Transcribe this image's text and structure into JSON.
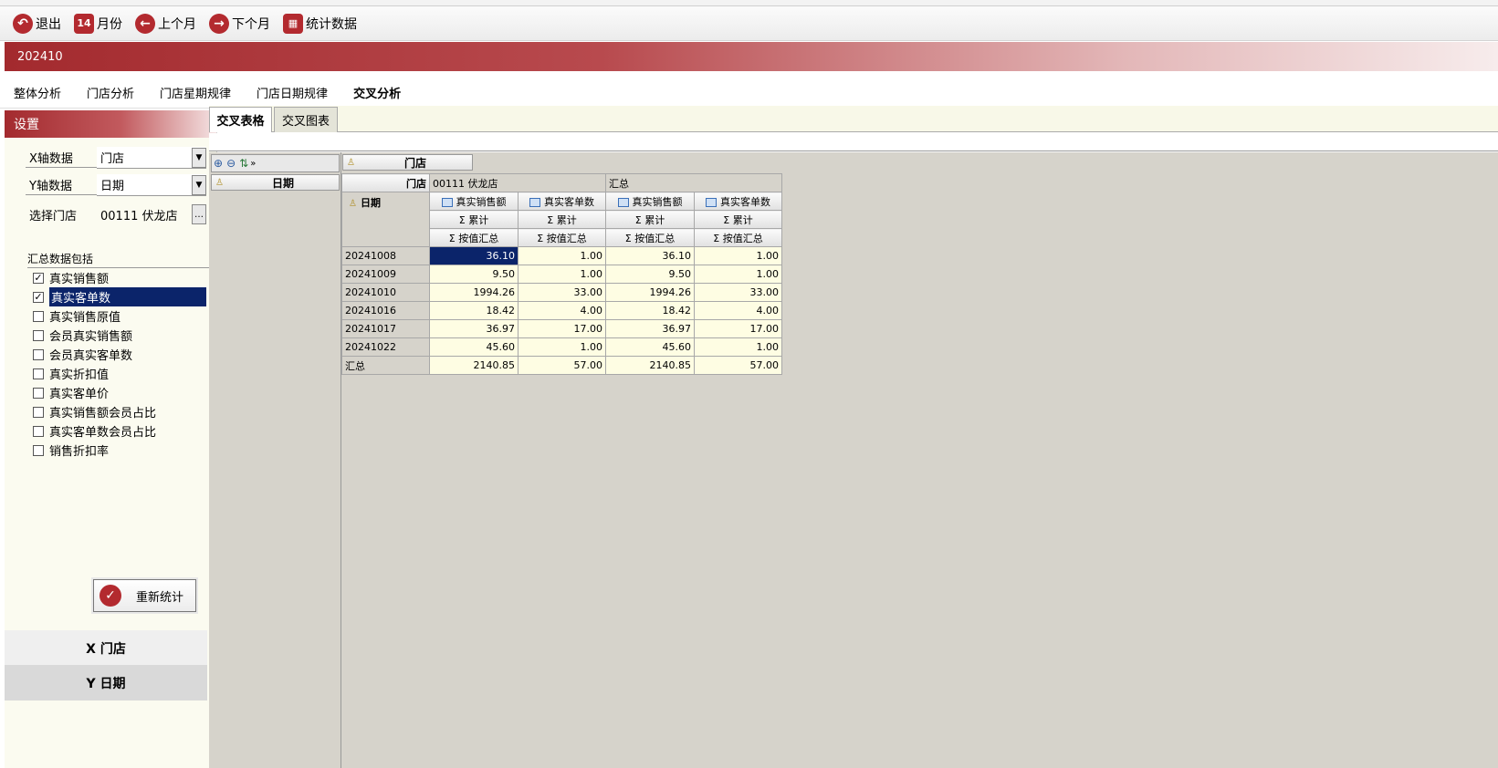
{
  "toolbar": {
    "exit": "退出",
    "month": "月份",
    "prev_month": "上个月",
    "next_month": "下个月",
    "stats": "统计数据"
  },
  "month_bar": {
    "period": "202410"
  },
  "main_tabs": [
    "整体分析",
    "门店分析",
    "门店星期规律",
    "门店日期规律",
    "交叉分析"
  ],
  "settings": {
    "title": "设置",
    "x_label": "X轴数据",
    "x_value": "门店",
    "y_label": "Y轴数据",
    "y_value": "日期",
    "store_label": "选择门店",
    "store_value": "00111 伏龙店",
    "summary_title": "汇总数据包括",
    "metrics": [
      {
        "label": "真实销售额",
        "checked": "✓"
      },
      {
        "label": "真实客单数",
        "checked": "✓"
      },
      {
        "label": "真实销售原值",
        "checked": ""
      },
      {
        "label": "会员真实销售额",
        "checked": ""
      },
      {
        "label": "会员真实客单数",
        "checked": ""
      },
      {
        "label": "真实折扣值",
        "checked": ""
      },
      {
        "label": "真实客单价",
        "checked": ""
      },
      {
        "label": "真实销售额会员占比",
        "checked": ""
      },
      {
        "label": "真实客单数会员占比",
        "checked": ""
      },
      {
        "label": "销售折扣率",
        "checked": ""
      }
    ],
    "rerun": "重新统计",
    "axis_x": "X 门店",
    "axis_y": "Y 日期"
  },
  "sub_tabs": [
    "交叉表格",
    "交叉图表"
  ],
  "pivot": {
    "col_field": "门店",
    "row_field": "日期",
    "store_header": "门店",
    "store_name": "00111 伏龙店",
    "total_header": "汇总",
    "measure_headers": [
      "真实销售额",
      "真实客单数",
      "真实销售额",
      "真实客单数"
    ],
    "agg_row": [
      "Σ 累计",
      "Σ 累计",
      "Σ 累计",
      "Σ 累计"
    ],
    "agg_row2": [
      "Σ 按值汇总",
      "Σ 按值汇总",
      "Σ 按值汇总",
      "Σ 按值汇总"
    ],
    "rows": [
      {
        "date": "20241008",
        "v": [
          "36.10",
          "1.00",
          "36.10",
          "1.00"
        ]
      },
      {
        "date": "20241009",
        "v": [
          "9.50",
          "1.00",
          "9.50",
          "1.00"
        ]
      },
      {
        "date": "20241010",
        "v": [
          "1994.26",
          "33.00",
          "1994.26",
          "33.00"
        ]
      },
      {
        "date": "20241016",
        "v": [
          "18.42",
          "4.00",
          "18.42",
          "4.00"
        ]
      },
      {
        "date": "20241017",
        "v": [
          "36.97",
          "17.00",
          "36.97",
          "17.00"
        ]
      },
      {
        "date": "20241022",
        "v": [
          "45.60",
          "1.00",
          "45.60",
          "1.00"
        ]
      },
      {
        "date": "汇总",
        "v": [
          "2140.85",
          "57.00",
          "2140.85",
          "57.00"
        ]
      }
    ]
  }
}
